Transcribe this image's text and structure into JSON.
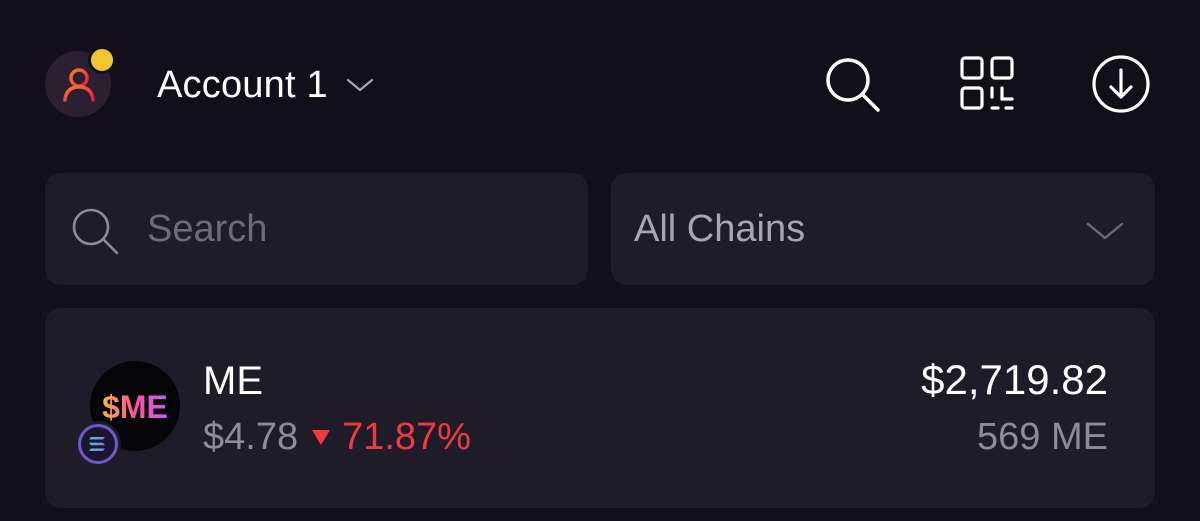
{
  "header": {
    "account_name": "Account 1",
    "avatar_icon": "user-icon",
    "notification_color": "#f3c530",
    "actions": [
      {
        "name": "search-icon"
      },
      {
        "name": "qr-code-icon"
      },
      {
        "name": "receive-download-icon"
      }
    ]
  },
  "filters": {
    "search_placeholder": "Search",
    "search_value": "",
    "chain_selected": "All Chains"
  },
  "tokens": [
    {
      "symbol": "ME",
      "price": "$4.78",
      "change": "71.87%",
      "change_direction": "down",
      "value": "$2,719.82",
      "amount": "569 ME",
      "logo_text": "$ME",
      "chain_icon": "solana-icon"
    }
  ],
  "colors": {
    "background": "#130f1a",
    "card": "#1f1b29",
    "negative": "#ef3b3d",
    "muted_text": "#8e8a9a"
  }
}
